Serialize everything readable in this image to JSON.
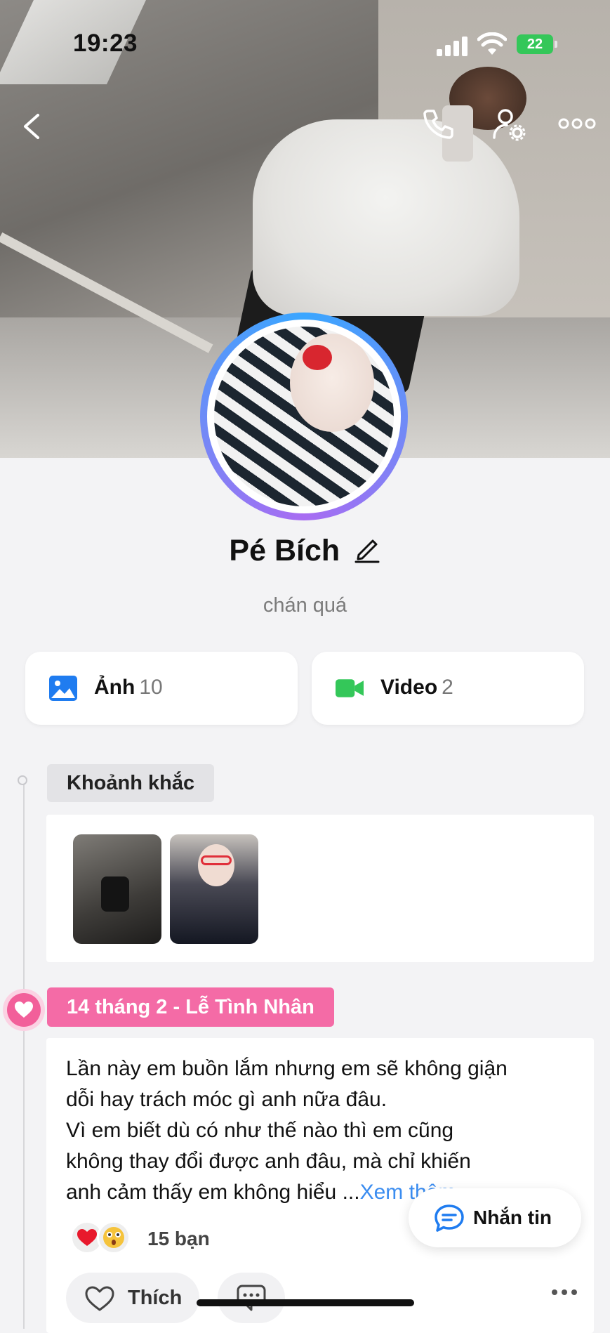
{
  "status_bar": {
    "time": "19:23",
    "battery": "22"
  },
  "icons": {
    "back": "chevron-left-icon",
    "call": "phone-icon",
    "settings": "user-gear-icon",
    "more": "more-horizontal-icon",
    "edit": "pencil-icon",
    "photo": "image-icon",
    "video": "video-camera-icon",
    "like": "heart-outline-icon",
    "comment": "comment-icon",
    "message": "chat-bubble-icon"
  },
  "profile": {
    "name": "Pé Bích",
    "bio": "chán quá"
  },
  "media": {
    "photos_label": "Ảnh",
    "photos_count": "10",
    "videos_label": "Video",
    "videos_count": "2"
  },
  "timeline": {
    "moments_label": "Khoảnh khắc",
    "event_label": "14 tháng 2 - Lễ Tình Nhân"
  },
  "post": {
    "text": "Lần này em buồn lắm nhưng em sẽ không giận\ndỗi hay trách móc gì anh nữa đâu.\nVì em biết dù có như thế nào thì em cũng\nkhông thay đổi được anh đâu, mà chỉ khiến\nanh cảm thấy em không hiểu ...",
    "more_link": "Xem thêm",
    "reaction_count": "15 bạn",
    "like_label": "Thích"
  },
  "actions": {
    "message_label": "Nhắn tin"
  },
  "colors": {
    "accent_pink": "#f46ba6",
    "accent_blue": "#3a8cf0",
    "video_green": "#34c759",
    "photo_blue": "#1f7cf0"
  }
}
